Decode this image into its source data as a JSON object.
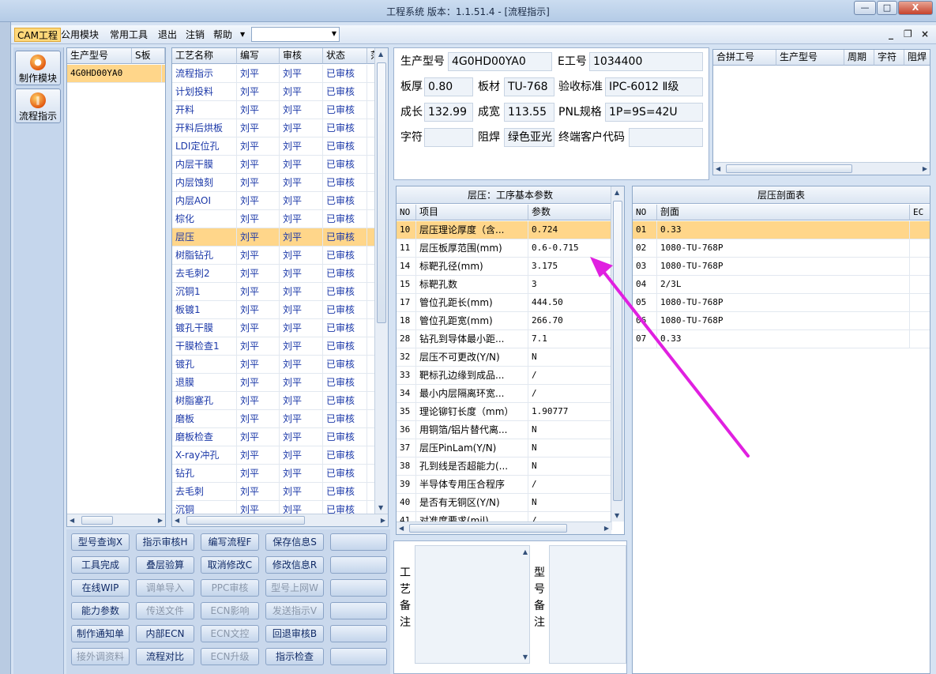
{
  "window": {
    "title": "工程系统 版本：1.1.51.4 - [流程指示]",
    "minimize": "—",
    "maximize": "□",
    "close": "X"
  },
  "menu": {
    "items": [
      "CAM工程",
      "公用模块",
      "常用工具",
      "退出",
      "注销",
      "帮助"
    ],
    "dropdown_arrow": "▼",
    "combo_value": ""
  },
  "mdi": {
    "minimize": "_",
    "restore": "❐",
    "close": "×"
  },
  "nav": [
    {
      "label": "制作模块",
      "icon": "production-module-icon"
    },
    {
      "label": "流程指示",
      "icon": "flow-instruction-icon"
    }
  ],
  "model_grid": {
    "headers": [
      "生产型号",
      "S板"
    ],
    "rows": [
      [
        "4G0HD00YA0",
        ""
      ]
    ]
  },
  "process_grid": {
    "headers": [
      "工艺名称",
      "编写",
      "审核",
      "状态",
      "范"
    ],
    "rows": [
      [
        "流程指示",
        "刘平",
        "刘平",
        "已审核"
      ],
      [
        "计划投料",
        "刘平",
        "刘平",
        "已审核"
      ],
      [
        "开料",
        "刘平",
        "刘平",
        "已审核"
      ],
      [
        "开料后烘板",
        "刘平",
        "刘平",
        "已审核"
      ],
      [
        "LDI定位孔",
        "刘平",
        "刘平",
        "已审核"
      ],
      [
        "内层干膜",
        "刘平",
        "刘平",
        "已审核"
      ],
      [
        "内层蚀刻",
        "刘平",
        "刘平",
        "已审核"
      ],
      [
        "内层AOI",
        "刘平",
        "刘平",
        "已审核"
      ],
      [
        "棕化",
        "刘平",
        "刘平",
        "已审核"
      ],
      [
        "层压",
        "刘平",
        "刘平",
        "已审核"
      ],
      [
        "树脂钻孔",
        "刘平",
        "刘平",
        "已审核"
      ],
      [
        "去毛刺2",
        "刘平",
        "刘平",
        "已审核"
      ],
      [
        "沉铜1",
        "刘平",
        "刘平",
        "已审核"
      ],
      [
        "板镀1",
        "刘平",
        "刘平",
        "已审核"
      ],
      [
        "镀孔干膜",
        "刘平",
        "刘平",
        "已审核"
      ],
      [
        "干膜检查1",
        "刘平",
        "刘平",
        "已审核"
      ],
      [
        "镀孔",
        "刘平",
        "刘平",
        "已审核"
      ],
      [
        "退膜",
        "刘平",
        "刘平",
        "已审核"
      ],
      [
        "树脂塞孔",
        "刘平",
        "刘平",
        "已审核"
      ],
      [
        "磨板",
        "刘平",
        "刘平",
        "已审核"
      ],
      [
        "磨板检查",
        "刘平",
        "刘平",
        "已审核"
      ],
      [
        "X-ray冲孔",
        "刘平",
        "刘平",
        "已审核"
      ],
      [
        "钻孔",
        "刘平",
        "刘平",
        "已审核"
      ],
      [
        "去毛刺",
        "刘平",
        "刘平",
        "已审核"
      ],
      [
        "沉铜",
        "刘平",
        "刘平",
        "已审核"
      ]
    ],
    "selected_index": 9
  },
  "buttons": [
    [
      "型号查询X",
      "指示审核H",
      "编写流程F",
      "保存信息S",
      ""
    ],
    [
      "工具完成",
      "叠层验算",
      "取消修改C",
      "修改信息R",
      ""
    ],
    [
      "在线WIP",
      "调单导入",
      "PPC审核",
      "型号上网W",
      ""
    ],
    [
      "能力参数",
      "传送文件",
      "ECN影响",
      "发送指示V",
      ""
    ],
    [
      "制作通知单",
      "内部ECN",
      "ECN文控",
      "回退审核B",
      ""
    ],
    [
      "接外调资料",
      "流程对比",
      "ECN升级",
      "指示检查",
      ""
    ]
  ],
  "info": {
    "model_label": "生产型号",
    "model": "4G0HD00YA0",
    "eno_label": "E工号",
    "eno": "1034400",
    "thick_label": "板厚",
    "thick": "0.80",
    "material_label": "板材",
    "material": "TU-768",
    "std_label": "验收标准",
    "std": "IPC-6012 Ⅱ级",
    "len_label": "成长",
    "len": "132.99",
    "width_label": "成宽",
    "width": "113.55",
    "pnl_label": "PNL规格",
    "pnl": "1P=9S=42U",
    "char_label": "字符",
    "char": "",
    "mask_label": "阻焊",
    "mask": "绿色亚光",
    "cust_label": "终端客户代码",
    "cust": ""
  },
  "merge_grid": {
    "headers": [
      "合拼工号",
      "生产型号",
      "周期",
      "字符",
      "阻焊"
    ]
  },
  "params": {
    "title": "层压：工序基本参数",
    "headers": [
      "NO",
      "项目",
      "参数"
    ],
    "rows": [
      [
        "10",
        "层压理论厚度（含...",
        "0.724"
      ],
      [
        "11",
        "层压板厚范围(mm)",
        "0.6-0.715"
      ],
      [
        "14",
        "标靶孔径(mm)",
        "3.175"
      ],
      [
        "15",
        "标靶孔数",
        "3"
      ],
      [
        "17",
        "管位孔距长(mm)",
        "444.50"
      ],
      [
        "18",
        "管位孔距宽(mm)",
        "266.70"
      ],
      [
        "28",
        "钻孔到导体最小距...",
        "7.1"
      ],
      [
        "32",
        "层压不可更改(Y/N)",
        "N"
      ],
      [
        "33",
        "靶标孔边缘到成品...",
        "/"
      ],
      [
        "34",
        "最小内层隔离环宽...",
        "/"
      ],
      [
        "35",
        "理论铆钉长度（mm）",
        "1.90777"
      ],
      [
        "36",
        "用铜箔/铝片替代离...",
        "N"
      ],
      [
        "37",
        "层压PinLam(Y/N)",
        "N"
      ],
      [
        "38",
        "孔到线是否超能力(...",
        "N"
      ],
      [
        "39",
        "半导体专用压合程序",
        "/"
      ],
      [
        "40",
        "是否有无铜区(Y/N)",
        "N"
      ],
      [
        "41",
        "对准度要求(mil)",
        "/"
      ]
    ],
    "highlight_no": "10"
  },
  "stackup": {
    "title": "层压剖面表",
    "headers": [
      "NO",
      "剖面",
      "EC"
    ],
    "rows": [
      [
        "01",
        "0.33"
      ],
      [
        "02",
        "1080-TU-768P"
      ],
      [
        "03",
        "1080-TU-768P"
      ],
      [
        "04",
        "2/3L"
      ],
      [
        "05",
        "1080-TU-768P"
      ],
      [
        "06",
        "1080-TU-768P"
      ],
      [
        "07",
        "0.33"
      ]
    ],
    "highlight_no": "01"
  },
  "remarks": {
    "process_label": "工艺备注",
    "model_label": "型号备注"
  },
  "colors": {
    "annotation_arrow": "#e020e0",
    "selected_row": "#ffd68a",
    "header_bg": "#dbe5f2"
  }
}
